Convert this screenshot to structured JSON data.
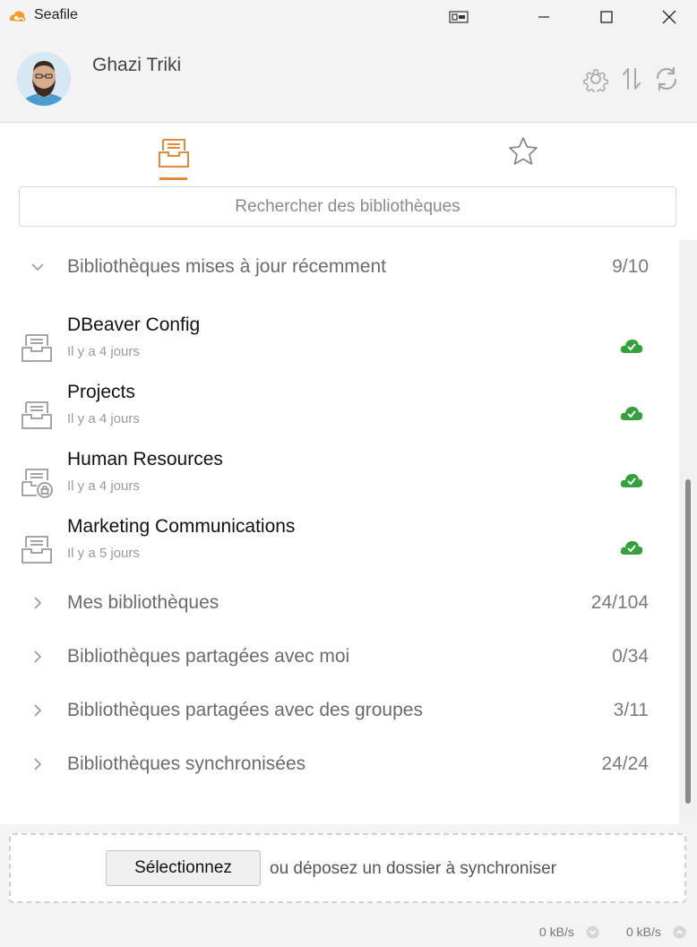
{
  "window": {
    "title": "Seafile",
    "accent_color": "#e58a3a",
    "status_ok_color": "#34a13a"
  },
  "header": {
    "user_name": "Ghazi Triki",
    "buttons": [
      "gear-icon",
      "transfer-icon",
      "refresh-icon"
    ]
  },
  "tabs": [
    {
      "name": "libraries",
      "icon": "library-icon",
      "active": true
    },
    {
      "name": "starred",
      "icon": "star-icon",
      "active": false
    }
  ],
  "search": {
    "placeholder": "Rechercher des bibliothèques",
    "value": ""
  },
  "groups": {
    "recent": {
      "label": "Bibliothèques mises à jour récemment",
      "count": "9/10",
      "expanded": true,
      "repos": [
        {
          "name": "DBeaver Config",
          "time": "Il y a 4 jours",
          "icon": "library-icon",
          "status": "synced"
        },
        {
          "name": "Projects",
          "time": "Il y a 4 jours",
          "icon": "library-icon",
          "status": "synced"
        },
        {
          "name": "Human Resources",
          "time": "Il y a 4 jours",
          "icon": "encrypted-library-icon",
          "status": "synced"
        },
        {
          "name": "Marketing Communications",
          "time": "Il y a 5 jours",
          "icon": "library-icon",
          "status": "synced"
        }
      ]
    },
    "mine": {
      "label": "Mes bibliothèques",
      "count": "24/104",
      "expanded": false
    },
    "shared_with_me": {
      "label": "Bibliothèques partagées avec moi",
      "count": "0/34",
      "expanded": false
    },
    "shared_with_groups": {
      "label": "Bibliothèques partagées avec des groupes",
      "count": "3/11",
      "expanded": false
    },
    "synced": {
      "label": "Bibliothèques synchronisées",
      "count": "24/24",
      "expanded": false
    }
  },
  "dropzone": {
    "button_label": "Sélectionnez",
    "text": "ou déposez un dossier à synchroniser"
  },
  "status": {
    "download_rate": "0 kB/s",
    "upload_rate": "0 kB/s"
  }
}
